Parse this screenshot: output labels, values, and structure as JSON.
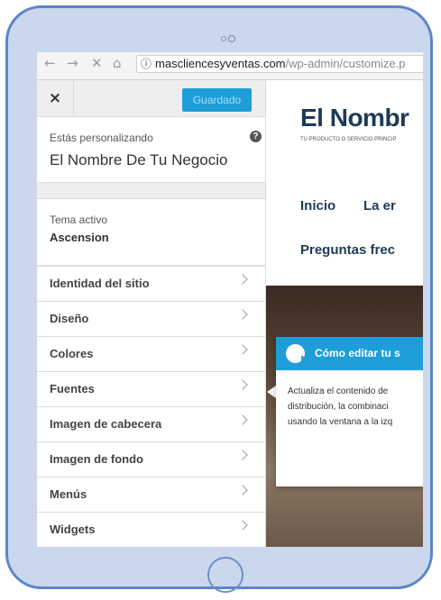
{
  "browser": {
    "back_icon": "←",
    "forward_icon": "→",
    "stop_icon": "✕",
    "home_icon": "⌂",
    "info_icon": "ⓘ",
    "url_host": "mascliencesyventas.com",
    "url_path": "/wp-admin/customize.p"
  },
  "panel": {
    "close_label": "×",
    "save_label": "Guardado",
    "customizing_label": "Estás personalizando",
    "help_label": "?",
    "site_name": "El Nombre De Tu Negocio",
    "theme_label": "Tema activo",
    "theme_name": "Ascension",
    "menu": [
      {
        "label": "Identidad del sitio"
      },
      {
        "label": "Diseño"
      },
      {
        "label": "Colores"
      },
      {
        "label": "Fuentes"
      },
      {
        "label": "Imagen de cabecera"
      },
      {
        "label": "Imagen de fondo"
      },
      {
        "label": "Menús"
      },
      {
        "label": "Widgets"
      }
    ]
  },
  "preview": {
    "brand": "El Nombr",
    "tagline": "TU PRODUCTO O SERVICIO PRINCIP",
    "nav": [
      "Inicio",
      "La er",
      "Preguntas frec"
    ]
  },
  "tooltip": {
    "title": "Cómo editar tu s",
    "body_lines": [
      "Actualiza el contenido de",
      "distribución, la combinaci",
      "usando la ventana a la izq"
    ]
  },
  "colors": {
    "accent": "#1e9ed8",
    "brand": "#1e3a55",
    "device_frame": "#5b86c9"
  }
}
